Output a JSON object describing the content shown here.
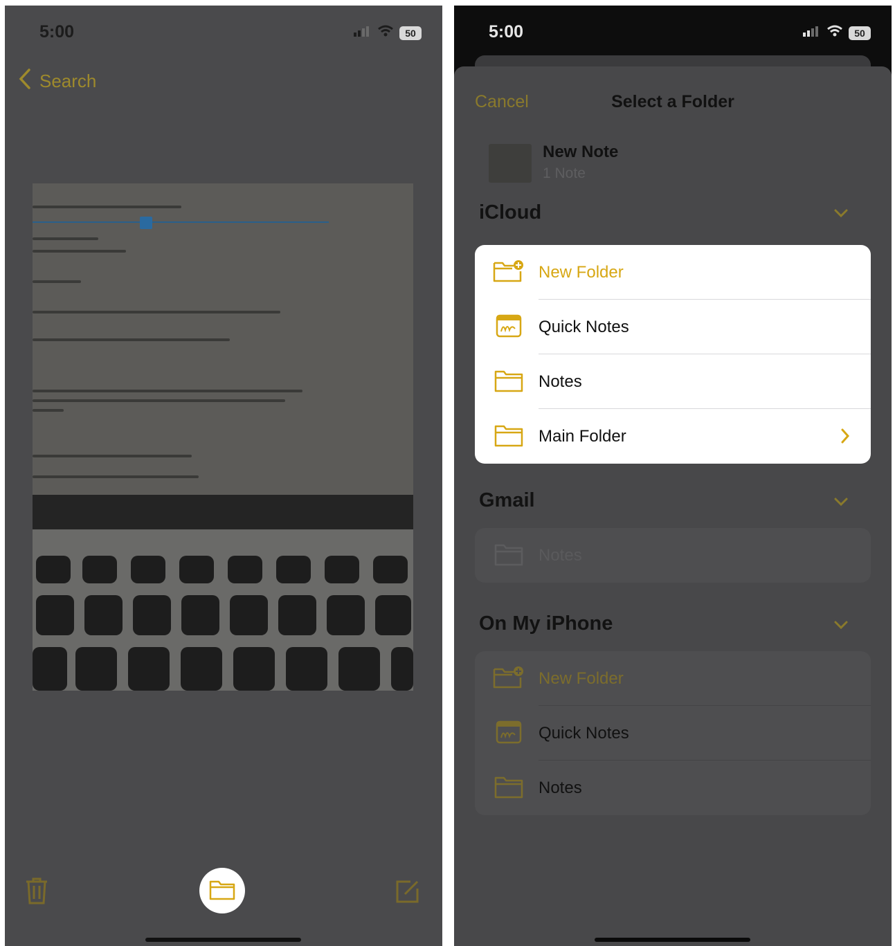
{
  "left": {
    "time": "5:00",
    "battery": "50",
    "back_label": "Search"
  },
  "right": {
    "time": "5:00",
    "battery": "50",
    "cancel_label": "Cancel",
    "title": "Select a Folder",
    "note": {
      "title": "New Note",
      "subtitle": "1 Note"
    },
    "sections": [
      {
        "name": "iCloud",
        "rows": [
          "New Folder",
          "Quick Notes",
          "Notes",
          "Main Folder"
        ]
      },
      {
        "name": "Gmail",
        "rows": [
          "Notes"
        ]
      },
      {
        "name": "On My iPhone",
        "rows": [
          "New Folder",
          "Quick Notes",
          "Notes"
        ]
      }
    ]
  },
  "colors": {
    "accent": "#d7a714",
    "dim_overlay": "#4a4a4c",
    "sheet": "#48484a",
    "highlight_card": "#ffffff"
  },
  "icons": [
    "back-chevron-icon",
    "signal-icon",
    "wifi-icon",
    "battery-icon",
    "trash-icon",
    "folder-icon",
    "compose-icon",
    "new-folder-icon",
    "quick-notes-icon",
    "chevron-down-icon",
    "chevron-right-icon"
  ]
}
